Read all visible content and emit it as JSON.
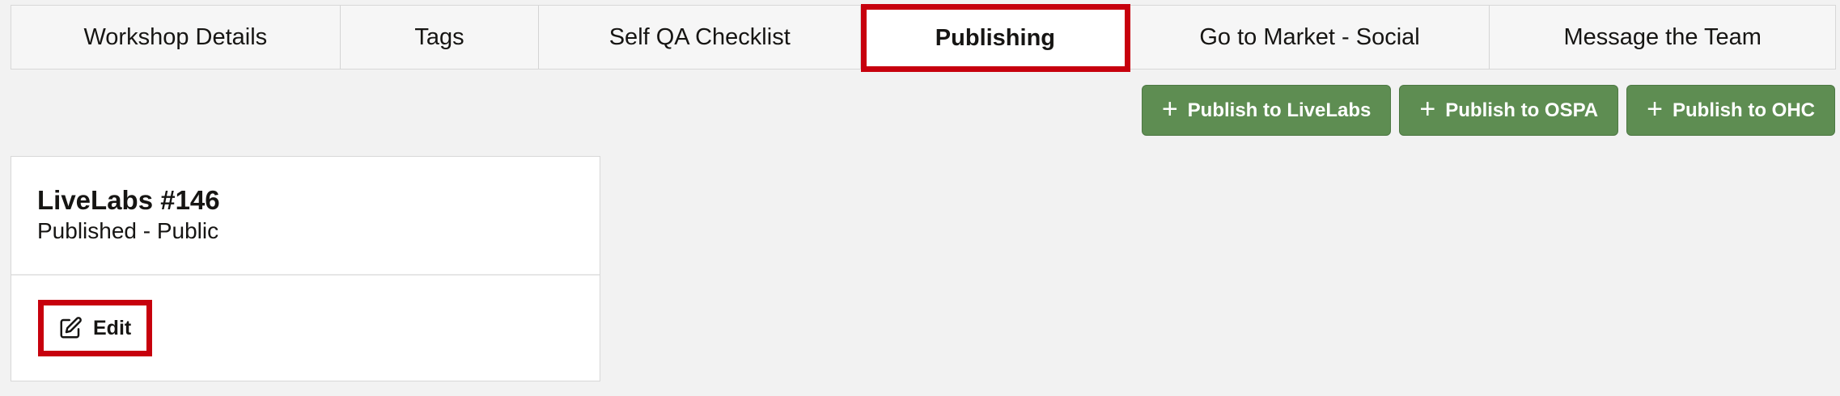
{
  "tabs": [
    {
      "label": "Workshop Details"
    },
    {
      "label": "Tags"
    },
    {
      "label": "Self QA Checklist"
    },
    {
      "label": "Publishing"
    },
    {
      "label": "Go to Market - Social"
    },
    {
      "label": "Message the Team"
    }
  ],
  "active_tab": "Publishing",
  "actions": {
    "livelabs_label": "Publish to LiveLabs",
    "ospa_label": "Publish to OSPA",
    "ohc_label": "Publish to OHC",
    "plus_glyph": "+"
  },
  "card": {
    "title": "LiveLabs #146",
    "status": "Published - Public",
    "edit_label": "Edit",
    "edit_icon": "pencil-square-icon"
  },
  "colors": {
    "highlight": "#c7000d",
    "publish_button": "#5e8d52",
    "background": "#f2f2f2"
  }
}
